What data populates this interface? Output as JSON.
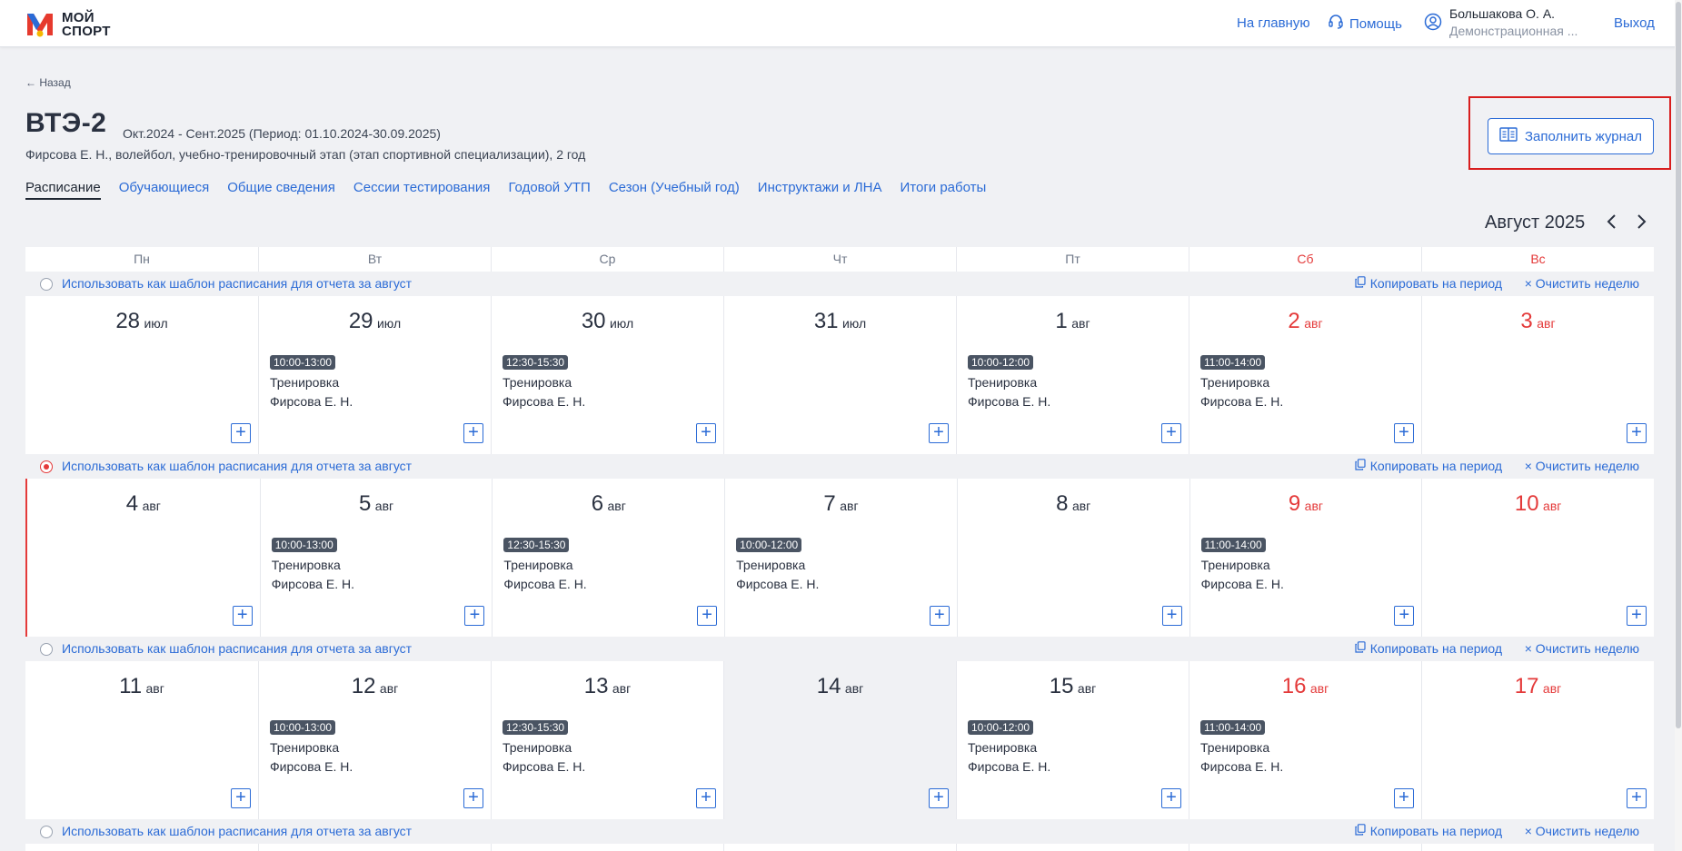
{
  "header": {
    "logo_text_1": "МОЙ",
    "logo_text_2": "СПОРТ",
    "home_link": "На главную",
    "help_link": "Помощь",
    "user_name": "Большакова О. А.",
    "user_org": "Демонстрационная ...",
    "logout": "Выход"
  },
  "page": {
    "back": "← Назад",
    "title": "ВТЭ-2",
    "period": "Окт.2024 - Сент.2025 (Период: 01.10.2024-30.09.2025)",
    "subtitle": "Фирсова Е. Н., волейбол, учебно-тренировочный этап (этап спортивной специализации), 2 год",
    "fill_journal": "Заполнить журнал"
  },
  "tabs": [
    "Расписание",
    "Обучающиеся",
    "Общие сведения",
    "Сессии тестирования",
    "Годовой УТП",
    "Сезон (Учебный год)",
    "Инструктажи и ЛНА",
    "Итоги работы"
  ],
  "calendar": {
    "month_label": "Август 2025",
    "prev": "‹",
    "next": "›",
    "weekdays": [
      "Пн",
      "Вт",
      "Ср",
      "Чт",
      "Пт",
      "Сб",
      "Вс"
    ],
    "template_label": "Использовать как шаблон расписания для отчета за август",
    "copy_label": "Копировать на период",
    "clear_label": "× Очистить неделю",
    "weeks": [
      {
        "selected": false,
        "days": [
          {
            "num": "28",
            "mon": "июл",
            "events": []
          },
          {
            "num": "29",
            "mon": "июл",
            "events": [
              {
                "time": "10:00-13:00",
                "name": "Тренировка",
                "coach": "Фирсова Е. Н."
              }
            ]
          },
          {
            "num": "30",
            "mon": "июл",
            "events": [
              {
                "time": "12:30-15:30",
                "name": "Тренировка",
                "coach": "Фирсова Е. Н."
              }
            ]
          },
          {
            "num": "31",
            "mon": "июл",
            "events": []
          },
          {
            "num": "1",
            "mon": "авг",
            "events": [
              {
                "time": "10:00-12:00",
                "name": "Тренировка",
                "coach": "Фирсова Е. Н."
              }
            ]
          },
          {
            "num": "2",
            "mon": "авг",
            "events": [
              {
                "time": "11:00-14:00",
                "name": "Тренировка",
                "coach": "Фирсова Е. Н."
              }
            ]
          },
          {
            "num": "3",
            "mon": "авг",
            "events": []
          }
        ]
      },
      {
        "selected": true,
        "days": [
          {
            "num": "4",
            "mon": "авг",
            "events": []
          },
          {
            "num": "5",
            "mon": "авг",
            "events": [
              {
                "time": "10:00-13:00",
                "name": "Тренировка",
                "coach": "Фирсова Е. Н."
              }
            ]
          },
          {
            "num": "6",
            "mon": "авг",
            "events": [
              {
                "time": "12:30-15:30",
                "name": "Тренировка",
                "coach": "Фирсова Е. Н."
              }
            ]
          },
          {
            "num": "7",
            "mon": "авг",
            "events": [
              {
                "time": "10:00-12:00",
                "name": "Тренировка",
                "coach": "Фирсова Е. Н."
              }
            ]
          },
          {
            "num": "8",
            "mon": "авг",
            "events": []
          },
          {
            "num": "9",
            "mon": "авг",
            "events": [
              {
                "time": "11:00-14:00",
                "name": "Тренировка",
                "coach": "Фирсова Е. Н."
              }
            ]
          },
          {
            "num": "10",
            "mon": "авг",
            "events": []
          }
        ]
      },
      {
        "selected": false,
        "today_index": 3,
        "days": [
          {
            "num": "11",
            "mon": "авг",
            "events": []
          },
          {
            "num": "12",
            "mon": "авг",
            "events": [
              {
                "time": "10:00-13:00",
                "name": "Тренировка",
                "coach": "Фирсова Е. Н."
              }
            ]
          },
          {
            "num": "13",
            "mon": "авг",
            "events": [
              {
                "time": "12:30-15:30",
                "name": "Тренировка",
                "coach": "Фирсова Е. Н."
              }
            ]
          },
          {
            "num": "14",
            "mon": "авг",
            "events": []
          },
          {
            "num": "15",
            "mon": "авг",
            "events": [
              {
                "time": "10:00-12:00",
                "name": "Тренировка",
                "coach": "Фирсова Е. Н."
              }
            ]
          },
          {
            "num": "16",
            "mon": "авг",
            "events": [
              {
                "time": "11:00-14:00",
                "name": "Тренировка",
                "coach": "Фирсова Е. Н."
              }
            ]
          },
          {
            "num": "17",
            "mon": "авг",
            "events": []
          }
        ]
      },
      {
        "selected": false,
        "partial": true,
        "days": []
      }
    ]
  },
  "colors": {
    "accent": "#2b6bd6",
    "weekend": "#e43a3a",
    "highlight_box": "#d81e1e"
  },
  "icons": [
    "logo-icon",
    "help-headset-icon",
    "user-circle-icon",
    "book-icon",
    "chevron-left-icon",
    "chevron-right-icon",
    "copy-icon",
    "plus-icon"
  ]
}
